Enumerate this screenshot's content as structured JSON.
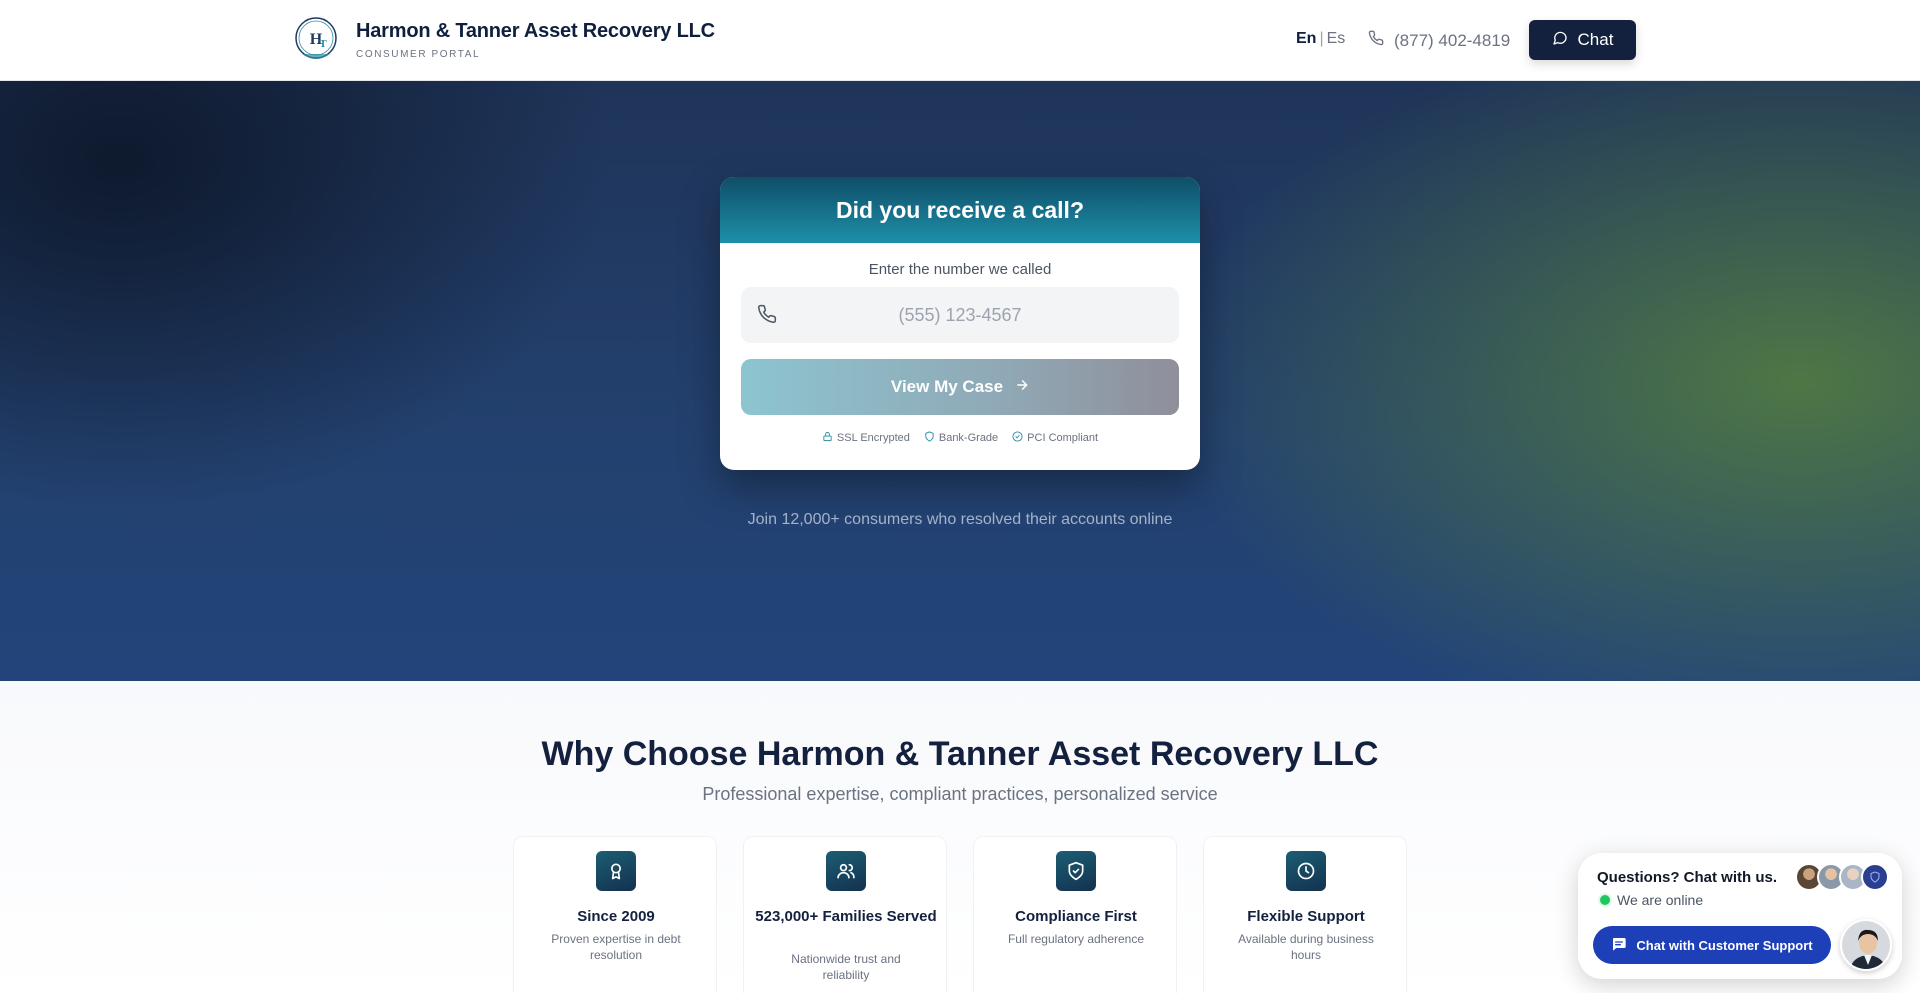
{
  "header": {
    "brand_name": "Harmon & Tanner Asset Recovery LLC",
    "brand_sub": "CONSUMER PORTAL",
    "logo_icon": "ht-monogram-logo",
    "lang_active": "En",
    "lang_separator": "|",
    "lang_other": "Es",
    "phone": "(877) 402-4819",
    "chat_label": "Chat"
  },
  "hero": {
    "card_title": "Did you receive a call?",
    "input_label": "Enter the number we called",
    "input_placeholder": "(555) 123-4567",
    "input_value": "",
    "cta_label": "View My Case",
    "badges": [
      "SSL Encrypted",
      "Bank-Grade",
      "PCI Compliant"
    ],
    "join_text": "Join 12,000+ consumers who resolved their accounts online"
  },
  "features": {
    "title": "Why Choose Harmon & Tanner Asset Recovery LLC",
    "subtitle": "Professional expertise, compliant practices, personalized service",
    "items": [
      {
        "icon": "award-icon",
        "title": "Since 2009",
        "desc": "Proven expertise in debt resolution"
      },
      {
        "icon": "users-icon",
        "title": "523,000+ Families Served",
        "desc": "Nationwide trust and reliability"
      },
      {
        "icon": "shield-check-icon",
        "title": "Compliance First",
        "desc": "Full regulatory adherence"
      },
      {
        "icon": "clock-icon",
        "title": "Flexible Support",
        "desc": "Available during business hours"
      }
    ]
  },
  "chat_widget": {
    "title": "Questions? Chat with us.",
    "status": "We are online",
    "button_label": "Chat with Customer Support"
  },
  "colors": {
    "navy": "#13213f",
    "teal_header": "#1e8fa8",
    "chat_blue": "#1d3fb8",
    "online_green": "#22c55e"
  }
}
